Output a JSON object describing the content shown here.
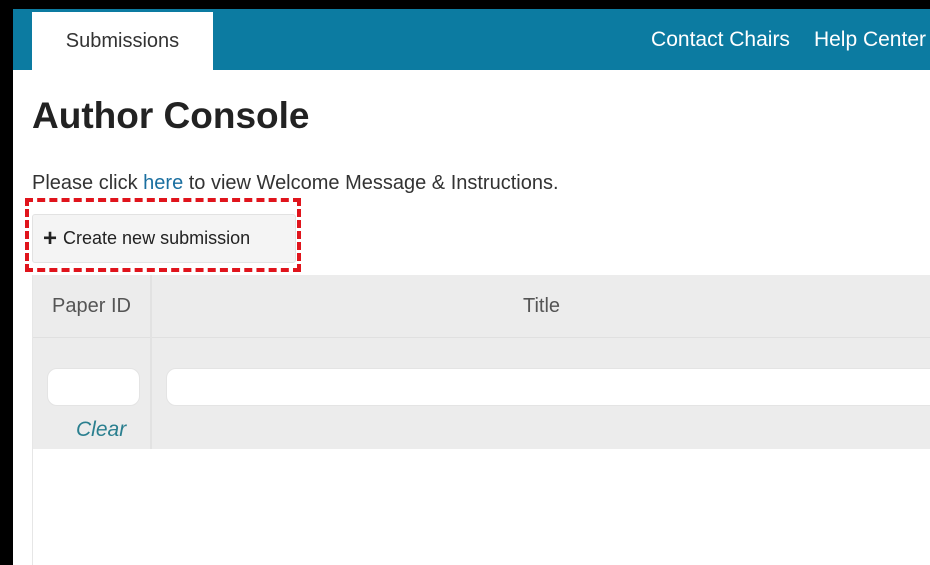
{
  "topbar": {
    "active_tab": "Submissions",
    "links": [
      "Contact Chairs",
      "Help Center"
    ]
  },
  "main": {
    "title": "Author Console",
    "welcome_prefix": "Please click ",
    "welcome_link": "here",
    "welcome_suffix": " to view Welcome Message & Instructions.",
    "create_button_icon": "+",
    "create_button_label": "Create new submission"
  },
  "table": {
    "columns": [
      "Paper ID",
      "Title"
    ],
    "filters": {
      "paper_id_value": "",
      "title_value": "",
      "clear_label": "Clear"
    }
  },
  "colors": {
    "topbar": "#0c7ba1",
    "highlight": "#e0141c",
    "link": "#1a6fa0",
    "clear_link": "#2a7f8f"
  },
  "icons": {
    "create_button": "plus-icon"
  }
}
